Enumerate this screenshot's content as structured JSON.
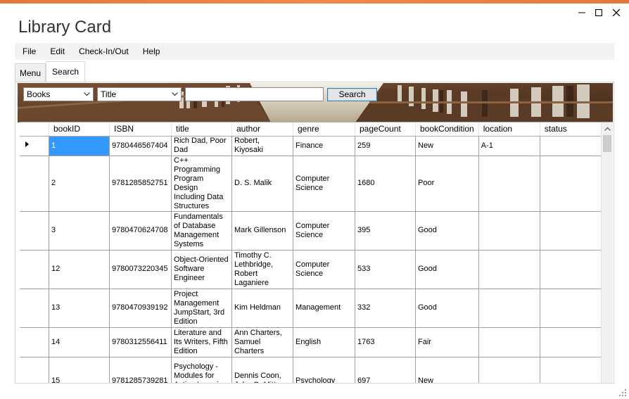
{
  "window": {
    "title": "Library Card",
    "controls": [
      "minimize-icon",
      "maximize-icon",
      "close-icon"
    ]
  },
  "menu": {
    "items": [
      "File",
      "Edit",
      "Check-In/Out",
      "Help"
    ]
  },
  "tabs": [
    {
      "label": "Menu",
      "active": false
    },
    {
      "label": "Search",
      "active": true
    }
  ],
  "search": {
    "category_value": "Books",
    "field_value": "Title",
    "query_value": "",
    "button_label": "Search"
  },
  "grid": {
    "columns": [
      "bookID",
      "ISBN",
      "title",
      "author",
      "genre",
      "pageCount",
      "bookCondition",
      "location",
      "status"
    ],
    "rows": [
      [
        "1",
        "9780446567404",
        "Rich Dad, Poor Dad",
        "Robert, Kiyosaki",
        "Finance",
        "259",
        "New",
        "A-1",
        ""
      ],
      [
        "2",
        "9781285852751",
        "C++ Programming Program Design Including Data Structures",
        "D. S. Malik",
        "Computer Science",
        "1680",
        "Poor",
        "",
        ""
      ],
      [
        "3",
        "9780470624708",
        "Fundamentals of Database Management Systems",
        "Mark Gillenson",
        "Computer Science",
        "395",
        "Good",
        "",
        ""
      ],
      [
        "12",
        "9780073220345",
        "Object-Oriented Software Engineer",
        "Timothy C. Lethbridge, Robert Laganiere",
        "Computer Science",
        "533",
        "Good",
        "",
        ""
      ],
      [
        "13",
        "9780470939192",
        "Project Management JumpStart, 3rd Edition",
        "Kim Heldman",
        "Management",
        "332",
        "Good",
        "",
        ""
      ],
      [
        "14",
        "9780312556411",
        "Literature and Its Writers, Fifth Edition",
        "Ann Charters, Samuel Charters",
        "English",
        "1763",
        "Fair",
        "",
        ""
      ],
      [
        "15",
        "9781285739281",
        "Psychology - Modules for Active Learning, Thirteenth",
        "Dennis Coon, John O. Mitterer",
        "Psychology",
        "697",
        "New",
        "",
        ""
      ]
    ],
    "selected_row": 0
  },
  "colors": {
    "accent": "#e87f42",
    "selection": "#3399ff",
    "button_border": "#3c7fb1"
  }
}
